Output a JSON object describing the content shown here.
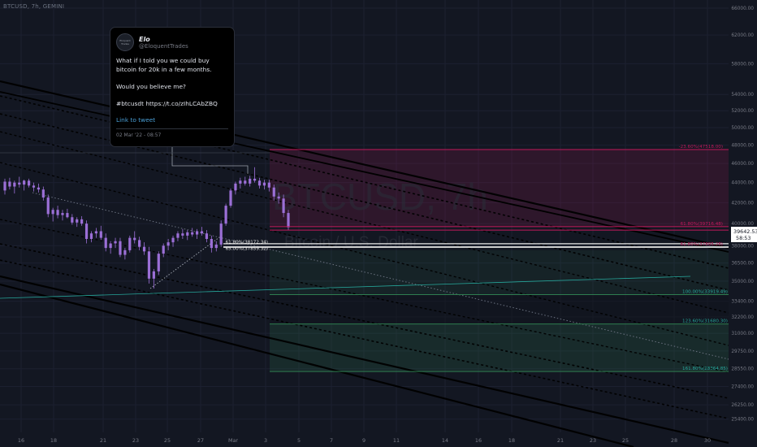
{
  "symbol": {
    "label": "BTCUSD, 7h, GEMINI"
  },
  "watermark": {
    "main": "BTCUSD, 7h",
    "sub": "Bitcoin / U.S. Dollar"
  },
  "tweet": {
    "name": "Elo",
    "handle": "@EloquentTrades",
    "avatar_text": "Eloquent Trades",
    "line1": "What if I told you we could buy bitcoin for 20k in a few months.",
    "line2": "Would you believe me?",
    "line3": "#btcusdt https://t.co/zIhLCAbZBQ",
    "link_label": "Link to tweet",
    "date": "02 Mar '22 - 08:57"
  },
  "colors": {
    "background": "#131722",
    "bull": "#9b6fd6",
    "bear": "#9b6fd6",
    "magenta": "#c2185b",
    "green_zone": "#2e7d4f",
    "teal": "#26a69a",
    "axis_text": "#787b86",
    "price_label_bg": "#ffffff"
  },
  "chart_data": {
    "type": "candlestick",
    "title": "BTCUSD, 7h, GEMINI",
    "y_axis": {
      "scale": "log",
      "range": [
        25000,
        66000
      ],
      "ticks": [
        66000,
        62000,
        58000,
        54000,
        52000,
        50000,
        48000,
        46000,
        44000,
        42000,
        40000,
        38000,
        36500,
        35000,
        33400,
        32200,
        31000,
        29750,
        28550,
        27400,
        26250,
        25400
      ]
    },
    "x_axis": {
      "ticks": [
        "16",
        "18",
        "21",
        "23",
        "25",
        "27",
        "Mar",
        "3",
        "5",
        "7",
        "9",
        "11",
        "14",
        "16",
        "18",
        "21",
        "23",
        "25",
        "28",
        "30"
      ]
    },
    "last_price": {
      "value": "39642.53",
      "countdown": "58:53"
    },
    "candles": [
      [
        43200,
        44400,
        42800,
        44100
      ],
      [
        44100,
        44500,
        43300,
        43600
      ],
      [
        43600,
        44200,
        42900,
        44000
      ],
      [
        44000,
        44600,
        43500,
        43800
      ],
      [
        43800,
        44300,
        43200,
        44200
      ],
      [
        44200,
        44400,
        43500,
        43700
      ],
      [
        43700,
        44000,
        43100,
        43500
      ],
      [
        43500,
        43900,
        43000,
        43300
      ],
      [
        43300,
        43600,
        42200,
        42500
      ],
      [
        42500,
        42800,
        40600,
        40900
      ],
      [
        40900,
        41500,
        40200,
        41300
      ],
      [
        41300,
        41700,
        40500,
        40800
      ],
      [
        40800,
        41300,
        40300,
        41000
      ],
      [
        41000,
        41400,
        40500,
        40600
      ],
      [
        40600,
        40900,
        39900,
        40100
      ],
      [
        40100,
        40600,
        39700,
        40400
      ],
      [
        40400,
        40700,
        39800,
        40000
      ],
      [
        40000,
        40300,
        38200,
        38600
      ],
      [
        38600,
        39300,
        38300,
        39100
      ],
      [
        39100,
        39600,
        38700,
        39300
      ],
      [
        39300,
        39800,
        38500,
        38700
      ],
      [
        38700,
        39100,
        37500,
        37800
      ],
      [
        37800,
        38400,
        37300,
        38200
      ],
      [
        38200,
        38700,
        37800,
        38400
      ],
      [
        38400,
        38700,
        37000,
        37200
      ],
      [
        37200,
        37800,
        36800,
        37600
      ],
      [
        37600,
        38900,
        37400,
        38700
      ],
      [
        38700,
        39300,
        38200,
        38500
      ],
      [
        38500,
        38800,
        37600,
        37900
      ],
      [
        37900,
        38300,
        37200,
        37500
      ],
      [
        37500,
        37900,
        34800,
        35200
      ],
      [
        35200,
        36000,
        34400,
        35800
      ],
      [
        35800,
        37500,
        35500,
        37300
      ],
      [
        37300,
        38200,
        37000,
        38000
      ],
      [
        38000,
        38600,
        37600,
        38300
      ],
      [
        38300,
        38900,
        37900,
        38700
      ],
      [
        38700,
        39300,
        38400,
        39100
      ],
      [
        39100,
        39500,
        38600,
        38900
      ],
      [
        38900,
        39400,
        38500,
        39200
      ],
      [
        39200,
        39600,
        38800,
        39000
      ],
      [
        39000,
        39500,
        38600,
        39300
      ],
      [
        39300,
        39700,
        38900,
        39100
      ],
      [
        39100,
        39400,
        38300,
        38600
      ],
      [
        38600,
        38900,
        37400,
        37800
      ],
      [
        37800,
        38400,
        37500,
        38100
      ],
      [
        38100,
        40300,
        37900,
        40000
      ],
      [
        40000,
        41900,
        39800,
        41700
      ],
      [
        41700,
        43400,
        41500,
        43200
      ],
      [
        43200,
        44100,
        42800,
        43900
      ],
      [
        43900,
        44500,
        43400,
        44200
      ],
      [
        44200,
        44600,
        43700,
        43900
      ],
      [
        43900,
        44700,
        43600,
        44400
      ],
      [
        44400,
        45600,
        44000,
        44200
      ],
      [
        44200,
        44500,
        43400,
        43700
      ],
      [
        43700,
        44300,
        43300,
        44000
      ],
      [
        44000,
        44300,
        43100,
        43500
      ],
      [
        43500,
        43800,
        42200,
        42600
      ],
      [
        42600,
        43000,
        41900,
        42400
      ],
      [
        42400,
        42800,
        40600,
        41000
      ],
      [
        41000,
        41300,
        39400,
        39650
      ]
    ],
    "fib_levels": [
      {
        "label": "-23.60%(47518.00)",
        "value": 47518.0,
        "zone": "resistance"
      },
      {
        "label": "61.80%(39716.48)",
        "value": 39716.48,
        "zone": "resistance"
      },
      {
        "label": "61.80%(38172.34)",
        "value": 38172.34,
        "zone": "entry"
      },
      {
        "label": "65.00%(37859.32)",
        "value": 37859.32,
        "zone": "entry"
      },
      {
        "label": "61.80%(37895.28)",
        "value": 37895.28,
        "zone": "entry"
      },
      {
        "label": "100.00%(33919.49)",
        "value": 33919.49,
        "zone": "target"
      },
      {
        "label": "123.60%(31680.30)",
        "value": 31680.3,
        "zone": "target"
      },
      {
        "label": "161.80%(28364.85)",
        "value": 28364.85,
        "zone": "target"
      }
    ]
  }
}
